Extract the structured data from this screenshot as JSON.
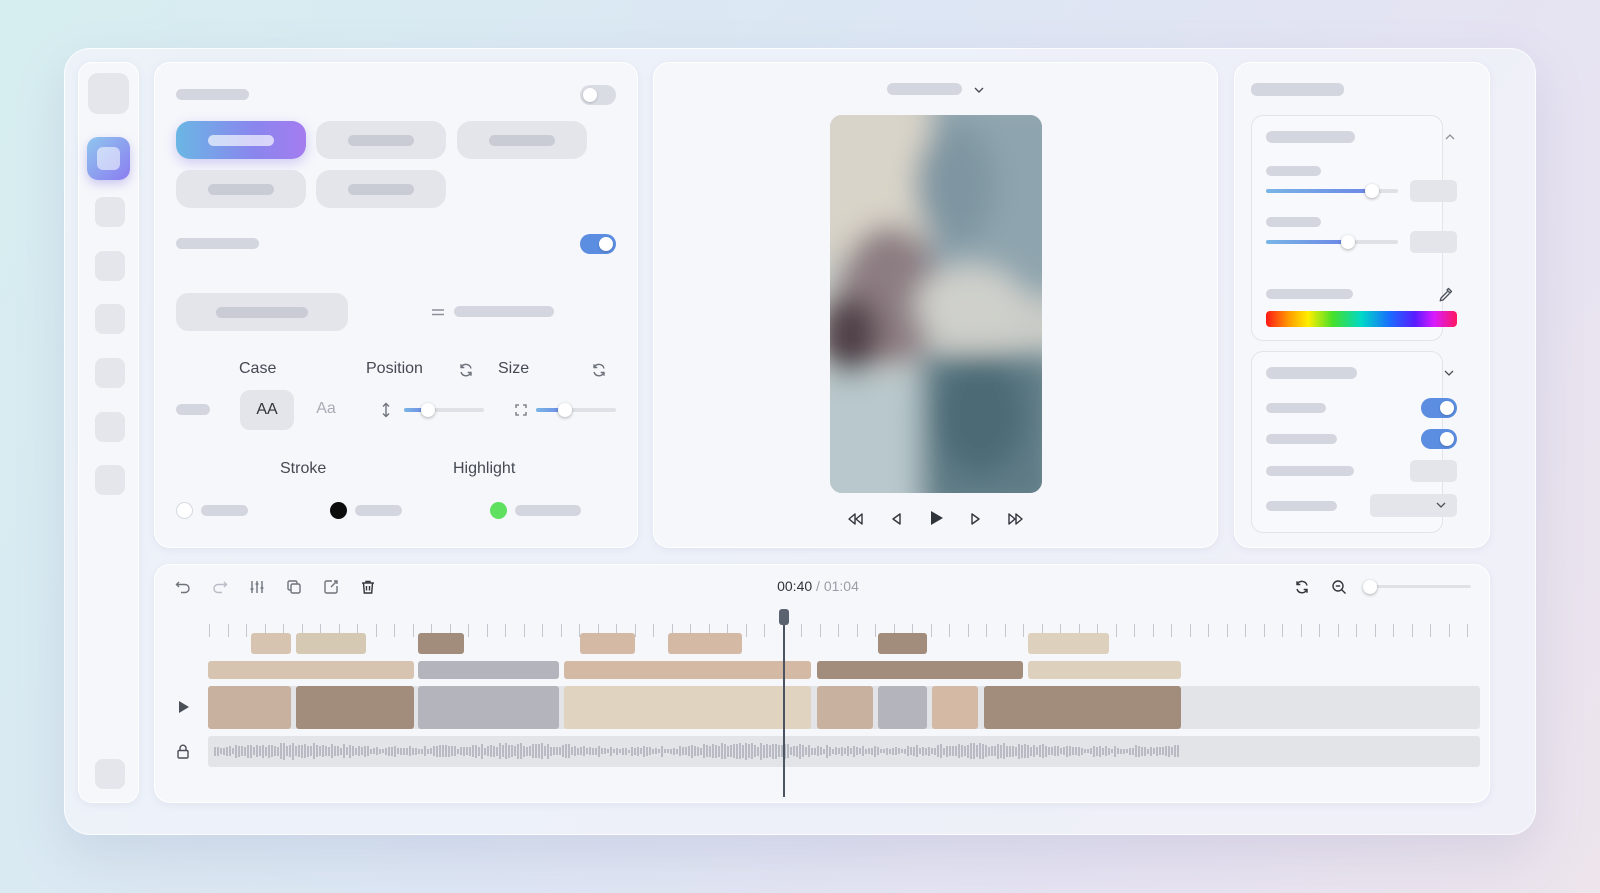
{
  "left_panel": {
    "case_label": "Case",
    "position_label": "Position",
    "size_label": "Size",
    "case_upper": "AA",
    "case_title": "Aa",
    "stroke_label": "Stroke",
    "highlight_label": "Highlight",
    "position_value": 0.3,
    "size_value": 0.36,
    "colors": {
      "none": "#ffffff",
      "stroke": "#0c0c0c",
      "highlight": "#5fe05f",
      "accent": "#5b8de0"
    },
    "toggle_top_on": false,
    "toggle_mid_on": true
  },
  "preview": {
    "playback_controls": [
      "rewind-icon",
      "step-back-icon",
      "play-icon",
      "step-forward-icon",
      "fast-forward-icon"
    ]
  },
  "right_panel": {
    "slider1_value": 0.8,
    "slider2_value": 0.62,
    "toggle1_on": true,
    "toggle2_on": true
  },
  "timeline": {
    "current_time": "00:40",
    "separator": " / ",
    "total_time": "01:04",
    "zoom_value": 0.0,
    "playhead_fraction": 0.625
  }
}
